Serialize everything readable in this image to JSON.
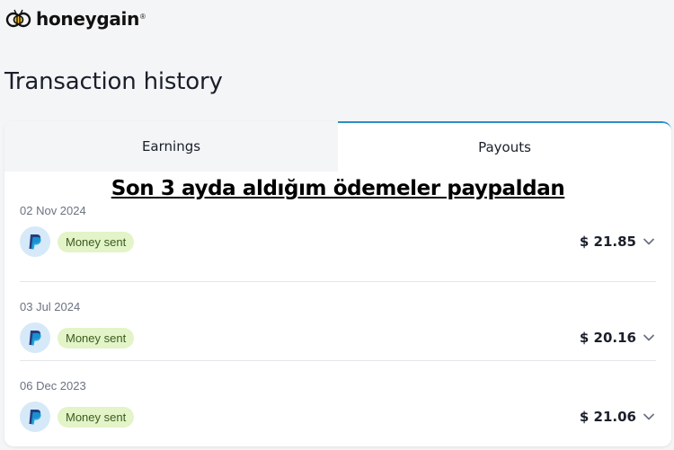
{
  "brand": {
    "name": "honeygain",
    "tm": "®"
  },
  "page": {
    "title": "Transaction history"
  },
  "tabs": [
    {
      "label": "Earnings",
      "active": false
    },
    {
      "label": "Payouts",
      "active": true
    }
  ],
  "annotation": "Son 3 ayda aldığım ödemeler paypaldan",
  "transactions": [
    {
      "date": "02 Nov 2024",
      "method_icon": "paypal-icon",
      "status": "Money sent",
      "amount": "$ 21.85"
    },
    {
      "date": "03 Jul 2024",
      "method_icon": "paypal-icon",
      "status": "Money sent",
      "amount": "$ 20.16"
    },
    {
      "date": "06 Dec 2023",
      "method_icon": "paypal-icon",
      "status": "Money sent",
      "amount": "$ 21.06"
    }
  ],
  "colors": {
    "accent": "#2b8fc9",
    "badge_bg": "#e2f4c8",
    "badge_text": "#3d5a1e",
    "paypal_dark": "#253b80",
    "paypal_light": "#179bd7"
  }
}
